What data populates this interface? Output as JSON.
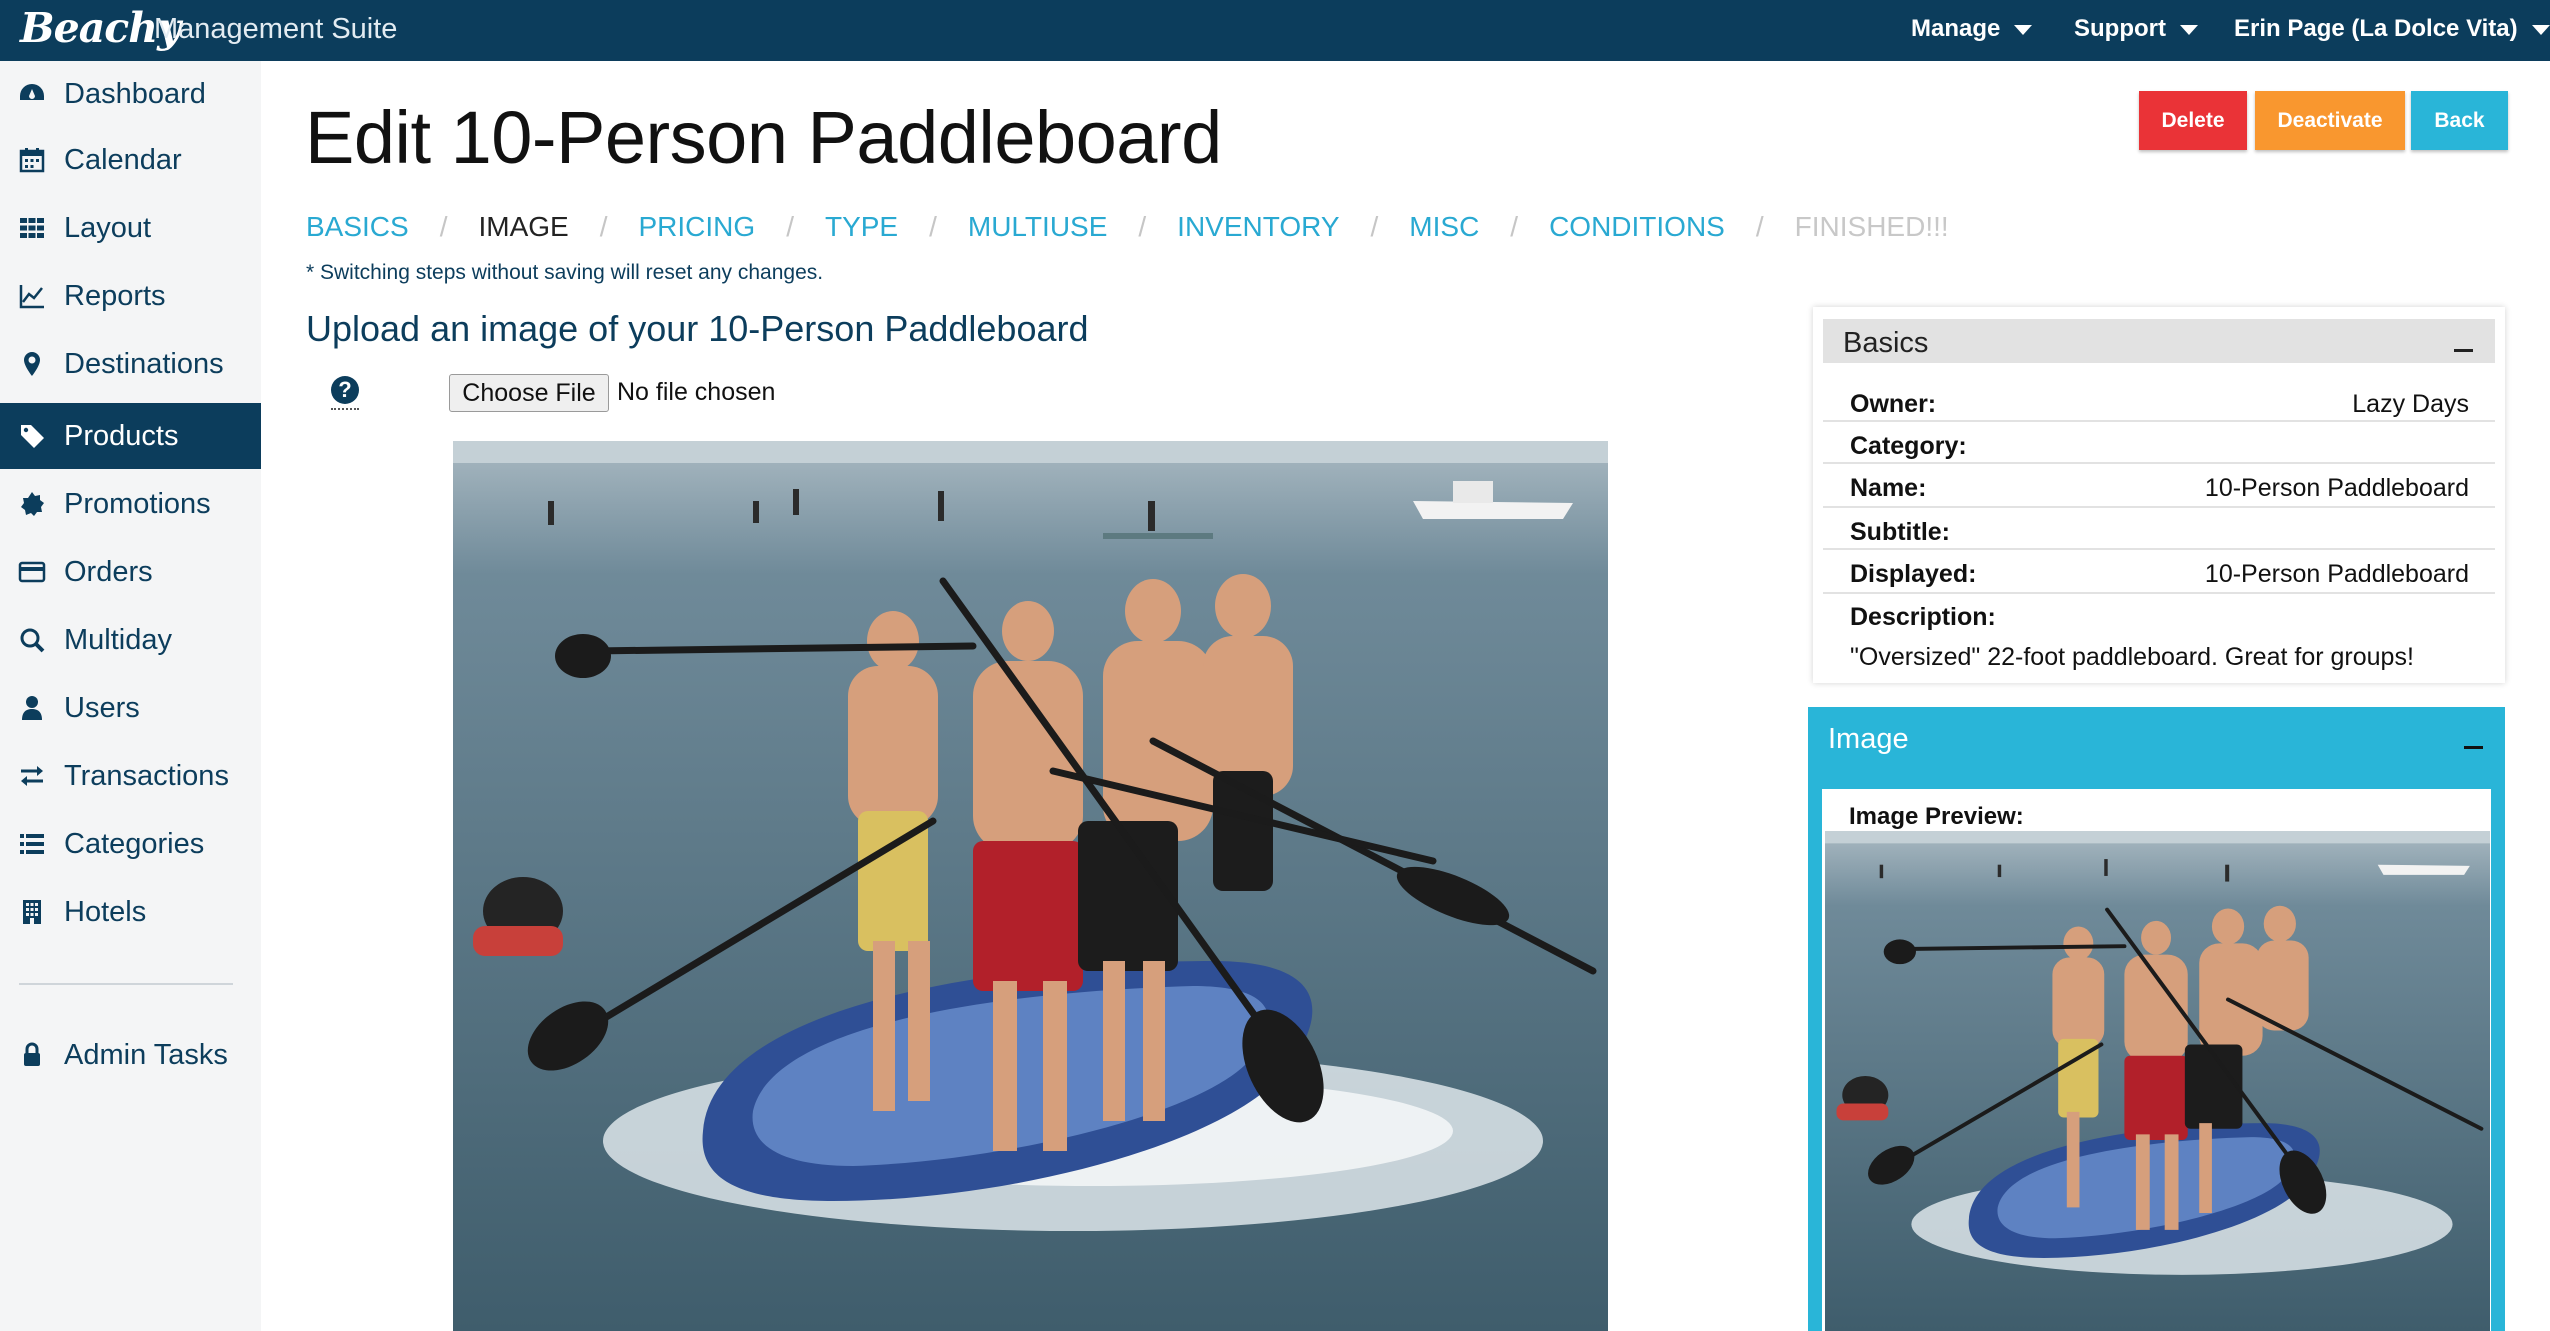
{
  "header": {
    "brand": "Beachy",
    "suite": "Management Suite",
    "nav": [
      {
        "label": "Manage"
      },
      {
        "label": "Support"
      },
      {
        "label": "Erin Page (La Dolce Vita)"
      }
    ]
  },
  "sidebar": {
    "items": [
      {
        "label": "Dashboard",
        "icon": "dashboard-icon"
      },
      {
        "label": "Calendar",
        "icon": "calendar-icon"
      },
      {
        "label": "Layout",
        "icon": "grid-icon"
      },
      {
        "label": "Reports",
        "icon": "line-chart-icon"
      },
      {
        "label": "Destinations",
        "icon": "map-marker-icon"
      },
      {
        "label": "Products",
        "icon": "tag-icon",
        "active": true
      },
      {
        "label": "Promotions",
        "icon": "badge-icon"
      },
      {
        "label": "Orders",
        "icon": "credit-card-icon"
      },
      {
        "label": "Multiday",
        "icon": "search-icon"
      },
      {
        "label": "Users",
        "icon": "user-icon"
      },
      {
        "label": "Transactions",
        "icon": "exchange-icon"
      },
      {
        "label": "Categories",
        "icon": "list-icon"
      },
      {
        "label": "Hotels",
        "icon": "building-icon"
      }
    ],
    "admin": {
      "label": "Admin Tasks",
      "icon": "lock-icon"
    }
  },
  "page": {
    "title": "Edit 10-Person Paddleboard",
    "buttons": {
      "delete": "Delete",
      "deactivate": "Deactivate",
      "back": "Back"
    },
    "steps": [
      {
        "label": "BASICS",
        "state": "link"
      },
      {
        "label": "IMAGE",
        "state": "current"
      },
      {
        "label": "PRICING",
        "state": "link"
      },
      {
        "label": "TYPE",
        "state": "link"
      },
      {
        "label": "MULTIUSE",
        "state": "link"
      },
      {
        "label": "INVENTORY",
        "state": "link"
      },
      {
        "label": "MISC",
        "state": "link"
      },
      {
        "label": "CONDITIONS",
        "state": "link"
      },
      {
        "label": "FINISHED!!!",
        "state": "disabled"
      }
    ],
    "step_separator": "/",
    "note": "* Switching steps without saving will reset any changes.",
    "upload_heading": "Upload an image of your 10-Person Paddleboard",
    "help_glyph": "?",
    "file_button": "Choose File",
    "file_status": "No file chosen"
  },
  "basics_panel": {
    "title": "Basics",
    "rows": [
      {
        "label": "Owner:",
        "value": "Lazy Days"
      },
      {
        "label": "Category:",
        "value": ""
      },
      {
        "label": "Name:",
        "value": "10-Person Paddleboard"
      },
      {
        "label": "Subtitle:",
        "value": ""
      },
      {
        "label": "Displayed:",
        "value": "10-Person Paddleboard"
      }
    ],
    "description_label": "Description:",
    "description_value": "\"Oversized\" 22-foot paddleboard. Great for groups!"
  },
  "image_panel": {
    "title": "Image",
    "preview_label": "Image Preview:"
  },
  "colors": {
    "header_bg": "#0c3d5c",
    "link": "#29a9d2",
    "delete": "#ea3337",
    "deactivate": "#f9972f",
    "back": "#29b5d8"
  }
}
